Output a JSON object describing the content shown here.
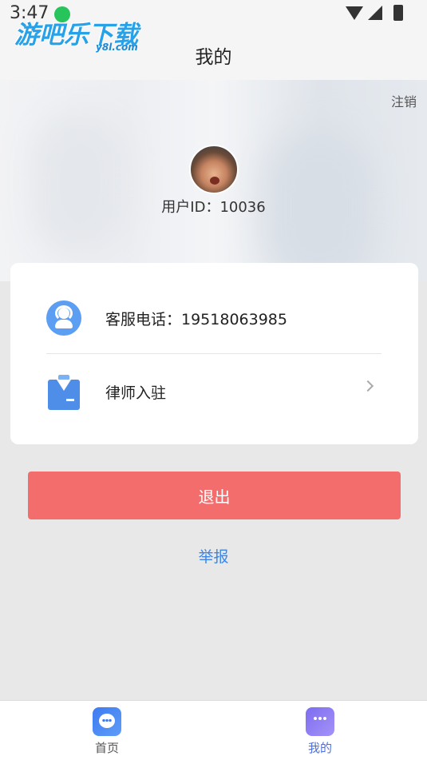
{
  "status_bar": {
    "time": "3:47",
    "watermark": "游吧乐下载",
    "watermark_sub": "y8l.com"
  },
  "header": {
    "title": "我的"
  },
  "profile": {
    "logout_label": "注销",
    "user_id_text": "用户ID：10036"
  },
  "menu": {
    "items": [
      {
        "label": "客服电话：19518063985",
        "icon": "customer-service-icon"
      },
      {
        "label": "律师入驻",
        "icon": "lawyer-suit-icon"
      }
    ]
  },
  "actions": {
    "exit_label": "退出",
    "report_label": "举报"
  },
  "bottom_nav": {
    "items": [
      {
        "label": "首页",
        "icon": "chat-bubble-icon"
      },
      {
        "label": "我的",
        "icon": "message-dots-icon",
        "active": true
      }
    ]
  },
  "colors": {
    "exit_button": "#f46d6d",
    "report_link": "#3a86e8",
    "active_nav": "#4b6fe8"
  }
}
